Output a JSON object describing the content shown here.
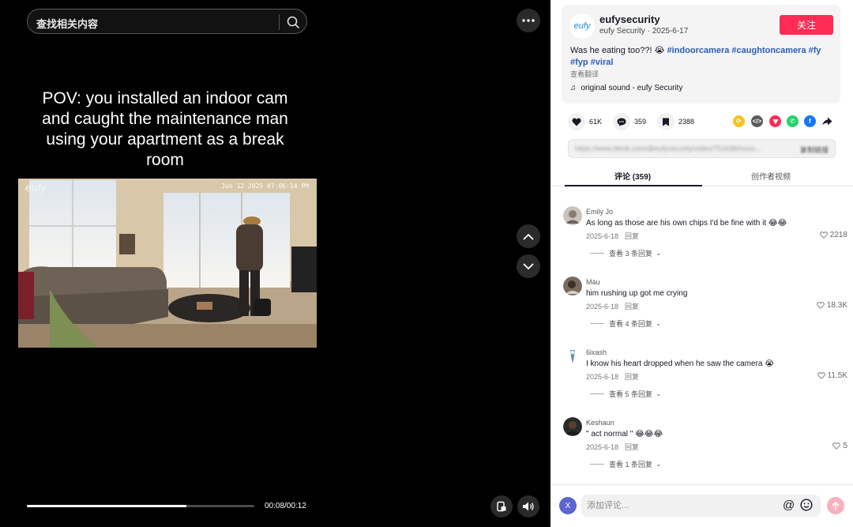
{
  "player": {
    "search": {
      "placeholder": "查找相关内容"
    },
    "caption": "POV: you installed an indoor cam and caught the maintenance man using your apartment as a break room",
    "camera_overlay": {
      "logo": "eufy",
      "timestamp": "Jun 12 2025   07:06:14 PM"
    },
    "playback": {
      "current": "00:08",
      "duration": "00:12",
      "time_label": "00:08/00:12",
      "progress": 0.7
    }
  },
  "author": {
    "avatar_text": "eufy",
    "username": "eufysecurity",
    "meta": "eufy Security · 2025-6-17",
    "follow_label": "关注"
  },
  "description": {
    "text": "Was he eating too??! 😭 ",
    "hashtags": "#indoorcamera #caughtoncamera #fy #fyp #viral",
    "translate_label": "查看翻译",
    "sound": "original sound - eufy Security"
  },
  "stats": {
    "likes": "61K",
    "comments": "359",
    "saves": "2388"
  },
  "share_icons": [
    "repost-icon",
    "embed-icon",
    "send-icon",
    "whatsapp-icon",
    "facebook-icon",
    "share-arrow-icon"
  ],
  "colors": {
    "accent": "#fe2c55",
    "hashtag": "#2b5db9",
    "whatsapp": "#25d366",
    "facebook": "#1877f2",
    "repost": "#f6c223",
    "send": "#fe2c55"
  },
  "link": {
    "url": "https://www.tiktok.com/@eufysecurity/video/7516360xxxx...",
    "copy_label": "复制链接"
  },
  "tabs": [
    {
      "label": "评论 (359)",
      "active": true
    },
    {
      "label": "创作者视频",
      "active": false
    }
  ],
  "comments": [
    {
      "user": "Emily Jo",
      "text": "As long as those are his own chips I'd be fine with it 😂😂",
      "date": "2025-6-18",
      "reply_label": "回复",
      "likes": "2218",
      "replies_label": "查看 3 条回复"
    },
    {
      "user": "Màu",
      "text": "him rushing up got me crying",
      "date": "2025-6-18",
      "reply_label": "回复",
      "likes": "18.3K",
      "replies_label": "查看 4 条回复"
    },
    {
      "user": "6ixash",
      "text": "I know his heart dropped when he saw the camera 😭",
      "date": "2025-6-18",
      "reply_label": "回复",
      "likes": "11.5K",
      "replies_label": "查看 5 条回复"
    },
    {
      "user": "Keshaun",
      "text": "\" act normal \" 😂😂😂",
      "date": "2025-6-18",
      "reply_label": "回复",
      "likes": "5",
      "replies_label": "查看 1 条回复"
    }
  ],
  "comment_box": {
    "avatar_text": "X",
    "placeholder": "添加评论..."
  }
}
